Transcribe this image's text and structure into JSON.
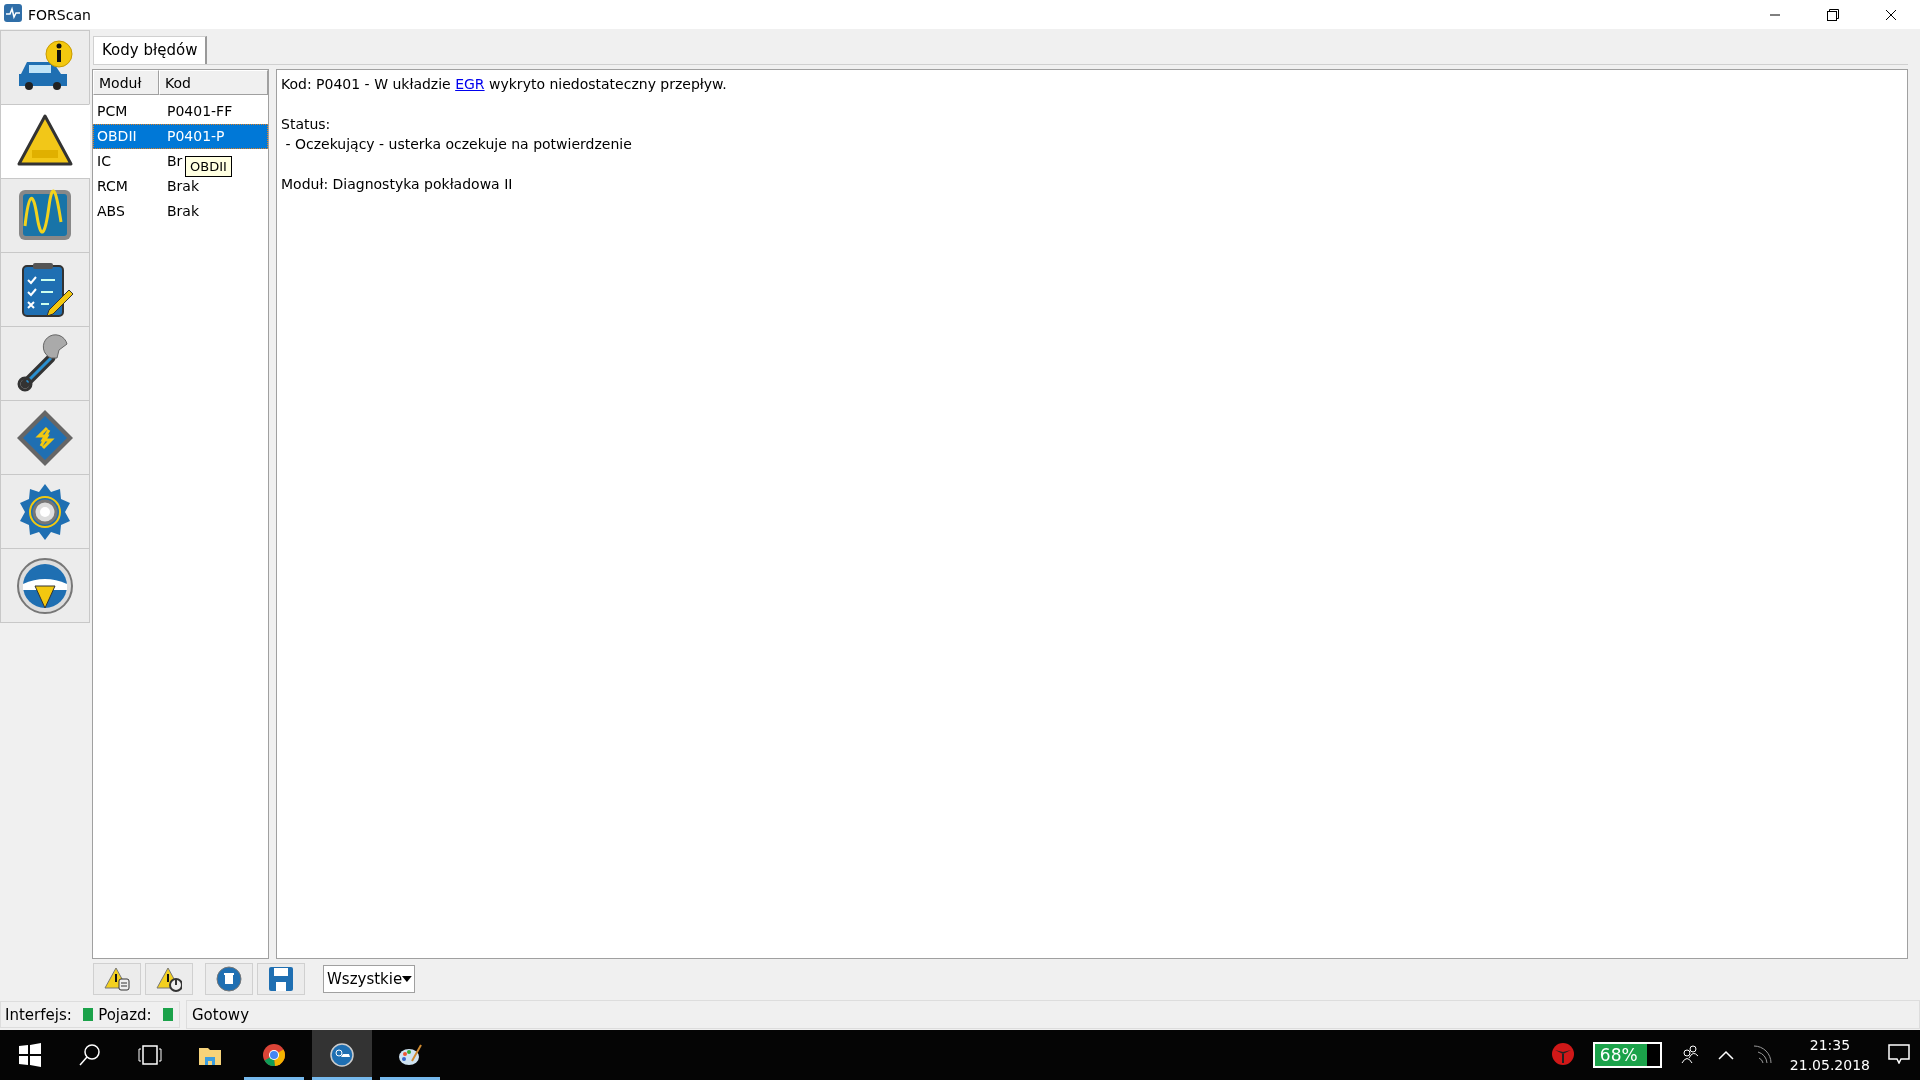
{
  "window": {
    "title": "FORScan"
  },
  "sidebar": {
    "items": [
      {
        "kind": "vehicle-info",
        "selected": false
      },
      {
        "kind": "dtc",
        "selected": true
      },
      {
        "kind": "oscilloscope",
        "selected": false
      },
      {
        "kind": "checklist",
        "selected": false
      },
      {
        "kind": "wrench",
        "selected": false
      },
      {
        "kind": "chip",
        "selected": false
      },
      {
        "kind": "gear",
        "selected": false
      },
      {
        "kind": "help",
        "selected": false
      }
    ]
  },
  "tabs": [
    {
      "label": "Kody błędów",
      "selected": true
    }
  ],
  "table": {
    "columns": [
      "Moduł",
      "Kod"
    ],
    "rows": [
      {
        "module": "PCM",
        "code": "P0401-FF",
        "selected": false
      },
      {
        "module": "OBDII",
        "code": "P0401-P",
        "selected": true
      },
      {
        "module": "IC",
        "code": "Br",
        "selected": false
      },
      {
        "module": "RCM",
        "code": "Brak",
        "selected": false
      },
      {
        "module": "ABS",
        "code": "Brak",
        "selected": false
      }
    ],
    "tooltip": {
      "text": "OBDII"
    }
  },
  "details": {
    "description": {
      "before": "Kod: P0401 - W układzie ",
      "link": "EGR",
      "after": " wykryto niedostateczny przepływ."
    },
    "status_label": "Status:",
    "status": " - Oczekujący - usterka oczekuje na potwierdzenie",
    "module": "Moduł: Diagnostyka pokładowa II"
  },
  "toolbar": {
    "buttons": [
      {
        "kind": "warning-doc"
      },
      {
        "kind": "warning-power"
      },
      {
        "kind": "delete"
      },
      {
        "kind": "save"
      }
    ],
    "filter": {
      "value": "Wszystkie"
    }
  },
  "status_bar": {
    "indicators": [
      {
        "label": "Interfejs:",
        "color": "#1ba24a"
      },
      {
        "label": "Pojazd:",
        "color": "#1ba24a"
      }
    ],
    "message": "Gotowy"
  },
  "taskbar": {
    "apps": [
      {
        "kind": "explorer",
        "running": false,
        "active": false
      },
      {
        "kind": "chrome",
        "running": true,
        "active": false
      },
      {
        "kind": "forscan",
        "running": true,
        "active": true
      },
      {
        "kind": "paint",
        "running": true,
        "active": false
      }
    ],
    "battery": "68%",
    "time": "21:35",
    "date": "21.05.2018"
  }
}
